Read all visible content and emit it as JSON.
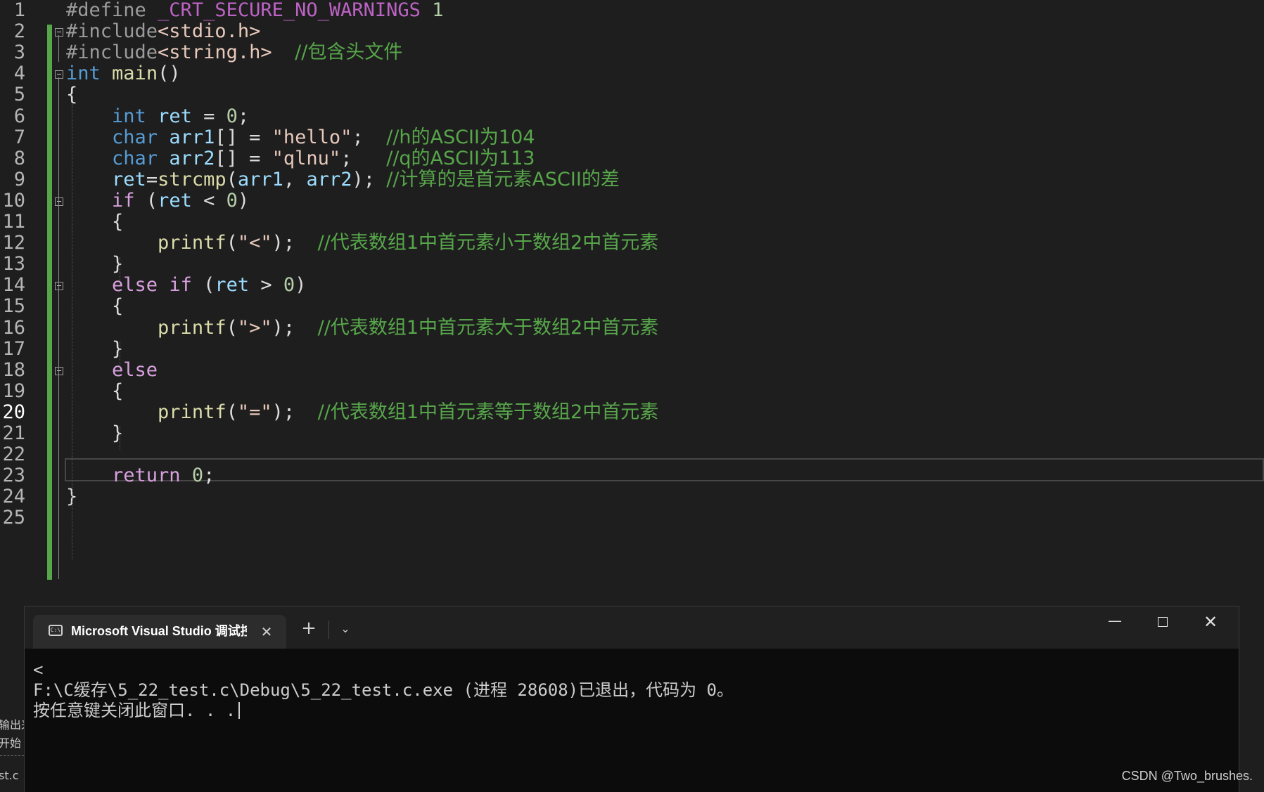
{
  "editor": {
    "current_line": 20,
    "lines": [
      {
        "n": "1",
        "parts": [
          {
            "c": "pp",
            "t": "#define "
          },
          {
            "c": "mac",
            "t": "_CRT_SECURE_NO_WARNINGS"
          },
          {
            "c": "punc",
            "t": " "
          },
          {
            "c": "num",
            "t": "1"
          }
        ]
      },
      {
        "n": "2",
        "parts": [
          {
            "c": "pp",
            "t": "#include"
          },
          {
            "c": "inc",
            "t": "<stdio.h>"
          }
        ]
      },
      {
        "n": "3",
        "parts": [
          {
            "c": "pp",
            "t": "#include"
          },
          {
            "c": "inc",
            "t": "<string.h>"
          },
          {
            "c": "punc",
            "t": "  "
          },
          {
            "c": "cmt",
            "t": "//包含头文件"
          }
        ]
      },
      {
        "n": "4",
        "parts": [
          {
            "c": "kw",
            "t": "int"
          },
          {
            "c": "punc",
            "t": " "
          },
          {
            "c": "fn",
            "t": "main"
          },
          {
            "c": "punc",
            "t": "()"
          }
        ]
      },
      {
        "n": "5",
        "parts": [
          {
            "c": "punc",
            "t": "{"
          }
        ]
      },
      {
        "n": "6",
        "parts": [
          {
            "c": "punc",
            "t": "    "
          },
          {
            "c": "kw",
            "t": "int"
          },
          {
            "c": "punc",
            "t": " "
          },
          {
            "c": "var",
            "t": "ret"
          },
          {
            "c": "punc",
            "t": " = "
          },
          {
            "c": "num",
            "t": "0"
          },
          {
            "c": "punc",
            "t": ";"
          }
        ]
      },
      {
        "n": "7",
        "parts": [
          {
            "c": "punc",
            "t": "    "
          },
          {
            "c": "kw",
            "t": "char"
          },
          {
            "c": "punc",
            "t": " "
          },
          {
            "c": "var",
            "t": "arr1"
          },
          {
            "c": "punc",
            "t": "[] = "
          },
          {
            "c": "str",
            "t": "\"hello\""
          },
          {
            "c": "punc",
            "t": ";  "
          },
          {
            "c": "cmt",
            "t": "//h的ASCII为104"
          }
        ]
      },
      {
        "n": "8",
        "parts": [
          {
            "c": "punc",
            "t": "    "
          },
          {
            "c": "kw",
            "t": "char"
          },
          {
            "c": "punc",
            "t": " "
          },
          {
            "c": "var",
            "t": "arr2"
          },
          {
            "c": "punc",
            "t": "[] = "
          },
          {
            "c": "str",
            "t": "\"qlnu\""
          },
          {
            "c": "punc",
            "t": ";   "
          },
          {
            "c": "cmt",
            "t": "//q的ASCII为113"
          }
        ]
      },
      {
        "n": "9",
        "parts": [
          {
            "c": "punc",
            "t": "    "
          },
          {
            "c": "var",
            "t": "ret"
          },
          {
            "c": "punc",
            "t": "="
          },
          {
            "c": "fn",
            "t": "strcmp"
          },
          {
            "c": "punc",
            "t": "("
          },
          {
            "c": "var",
            "t": "arr1"
          },
          {
            "c": "punc",
            "t": ", "
          },
          {
            "c": "var",
            "t": "arr2"
          },
          {
            "c": "punc",
            "t": "); "
          },
          {
            "c": "cmt",
            "t": "//计算的是首元素ASCII的差"
          }
        ]
      },
      {
        "n": "10",
        "parts": [
          {
            "c": "punc",
            "t": "    "
          },
          {
            "c": "kwc",
            "t": "if"
          },
          {
            "c": "punc",
            "t": " ("
          },
          {
            "c": "var",
            "t": "ret"
          },
          {
            "c": "punc",
            "t": " < "
          },
          {
            "c": "num",
            "t": "0"
          },
          {
            "c": "punc",
            "t": ")"
          }
        ]
      },
      {
        "n": "11",
        "parts": [
          {
            "c": "punc",
            "t": "    {"
          }
        ]
      },
      {
        "n": "12",
        "parts": [
          {
            "c": "punc",
            "t": "        "
          },
          {
            "c": "fn",
            "t": "printf"
          },
          {
            "c": "punc",
            "t": "("
          },
          {
            "c": "str",
            "t": "\"<\""
          },
          {
            "c": "punc",
            "t": ");  "
          },
          {
            "c": "cmt",
            "t": "//代表数组1中首元素小于数组2中首元素"
          }
        ]
      },
      {
        "n": "13",
        "parts": [
          {
            "c": "punc",
            "t": "    }"
          }
        ]
      },
      {
        "n": "14",
        "parts": [
          {
            "c": "punc",
            "t": "    "
          },
          {
            "c": "kwc",
            "t": "else"
          },
          {
            "c": "punc",
            "t": " "
          },
          {
            "c": "kwc",
            "t": "if"
          },
          {
            "c": "punc",
            "t": " ("
          },
          {
            "c": "var",
            "t": "ret"
          },
          {
            "c": "punc",
            "t": " > "
          },
          {
            "c": "num",
            "t": "0"
          },
          {
            "c": "punc",
            "t": ")"
          }
        ]
      },
      {
        "n": "15",
        "parts": [
          {
            "c": "punc",
            "t": "    {"
          }
        ]
      },
      {
        "n": "16",
        "parts": [
          {
            "c": "punc",
            "t": "        "
          },
          {
            "c": "fn",
            "t": "printf"
          },
          {
            "c": "punc",
            "t": "("
          },
          {
            "c": "str",
            "t": "\">\""
          },
          {
            "c": "punc",
            "t": ");  "
          },
          {
            "c": "cmt",
            "t": "//代表数组1中首元素大于数组2中首元素"
          }
        ]
      },
      {
        "n": "17",
        "parts": [
          {
            "c": "punc",
            "t": "    }"
          }
        ]
      },
      {
        "n": "18",
        "parts": [
          {
            "c": "punc",
            "t": "    "
          },
          {
            "c": "kwc",
            "t": "else"
          }
        ]
      },
      {
        "n": "19",
        "parts": [
          {
            "c": "punc",
            "t": "    {"
          }
        ]
      },
      {
        "n": "20",
        "parts": [
          {
            "c": "punc",
            "t": "        "
          },
          {
            "c": "fn",
            "t": "printf"
          },
          {
            "c": "punc",
            "t": "("
          },
          {
            "c": "str",
            "t": "\"=\""
          },
          {
            "c": "punc",
            "t": ");  "
          },
          {
            "c": "cmt",
            "t": "//代表数组1中首元素等于数组2中首元素"
          }
        ]
      },
      {
        "n": "21",
        "parts": [
          {
            "c": "punc",
            "t": "    }"
          }
        ]
      },
      {
        "n": "22",
        "parts": []
      },
      {
        "n": "23",
        "parts": [
          {
            "c": "punc",
            "t": "    "
          },
          {
            "c": "kwc",
            "t": "return"
          },
          {
            "c": "punc",
            "t": " "
          },
          {
            "c": "num",
            "t": "0"
          },
          {
            "c": "punc",
            "t": ";"
          }
        ]
      },
      {
        "n": "24",
        "parts": [
          {
            "c": "punc",
            "t": "}"
          }
        ]
      },
      {
        "n": "25",
        "parts": []
      }
    ]
  },
  "console": {
    "tab_title": "Microsoft Visual Studio 调试控制台",
    "tab_icon_text": "C:\\",
    "tab_close": "✕",
    "new_tab": "+",
    "dropdown": "⌄",
    "minimize": "—",
    "close": "✕",
    "output_lines": [
      "<",
      "F:\\C缓存\\5_22_test.c\\Debug\\5_22_test.c.exe (进程 28608)已退出，代码为 0。",
      "按任意键关闭此窗口. . ."
    ]
  },
  "background_panel": {
    "text_1": "输出来",
    "text_2": "开始",
    "text_3": "st.c"
  },
  "watermark": "CSDN @Two_brushes."
}
